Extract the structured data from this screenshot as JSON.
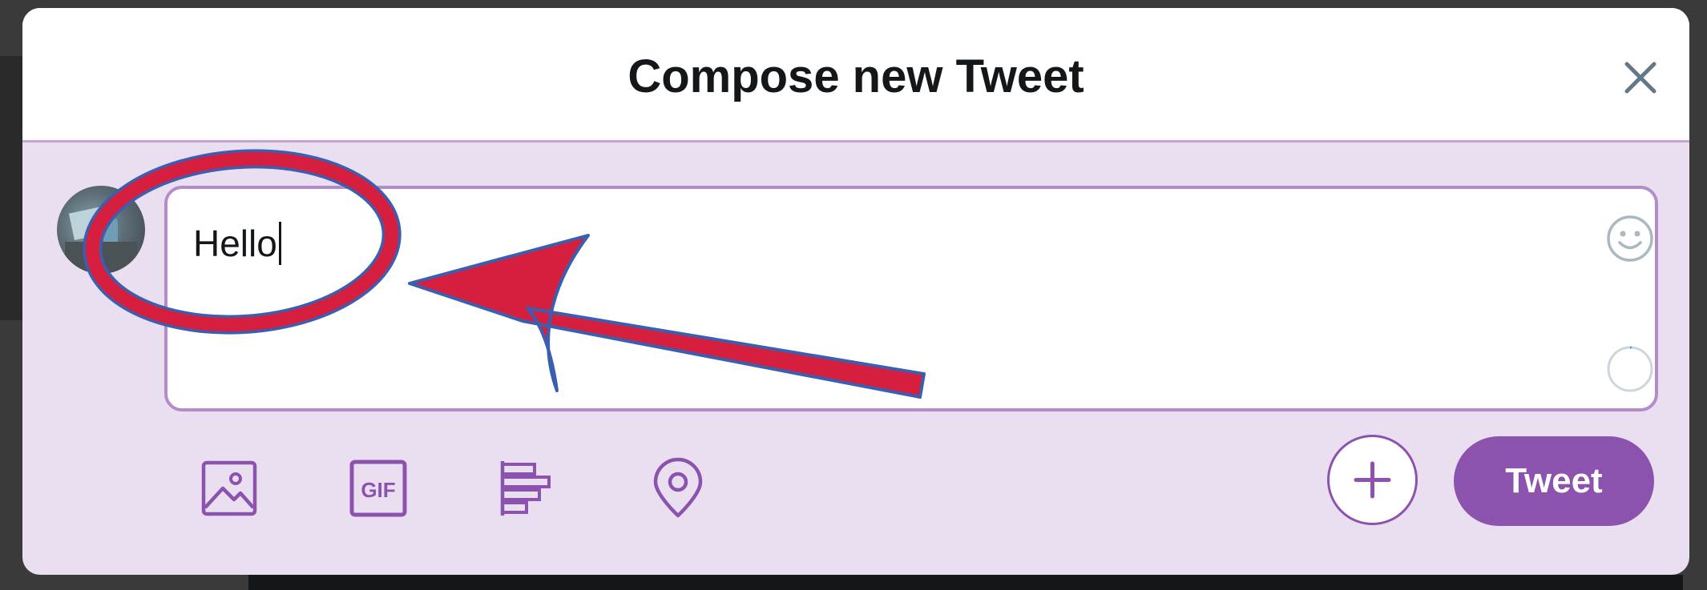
{
  "dialog": {
    "title": "Compose new Tweet",
    "close_icon": "close-icon"
  },
  "composer": {
    "text": "Hello",
    "emoji_icon": "smiley-icon",
    "progress": 0.01
  },
  "toolbar": {
    "icons": [
      "image-icon",
      "gif-icon",
      "poll-icon",
      "location-icon"
    ],
    "gif_label": "GIF",
    "add_icon": "plus-icon",
    "tweet_label": "Tweet"
  },
  "colors": {
    "accent": "#8b53ad",
    "panel_background": "#eadff0",
    "annotation": "#d61f3f"
  }
}
